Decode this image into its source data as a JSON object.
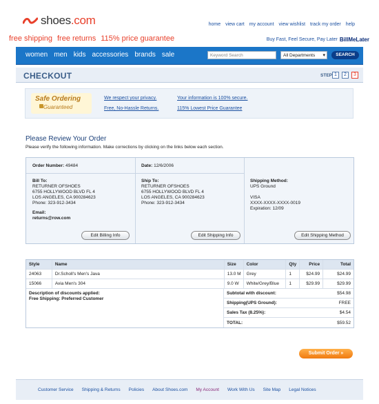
{
  "brand": {
    "logo_text": "shoes",
    "logo_suffix": ".com"
  },
  "top_links": [
    "home",
    "view cart",
    "my account",
    "view wishlist",
    "track my order",
    "help"
  ],
  "promo": [
    "free shipping",
    "free returns",
    "115% price guarantee"
  ],
  "bml": {
    "text": "Buy Fast, Feel Secure, Pay Later",
    "badge": "BillMeLater"
  },
  "nav": {
    "items": [
      "women",
      "men",
      "kids",
      "accessories",
      "brands",
      "sale"
    ],
    "search_placeholder": "Keyword Search",
    "dept_selected": "All Departments",
    "search_button": "SEARCH"
  },
  "checkout": {
    "title": "CHECKOUT",
    "step_label": "STEP",
    "steps": [
      "1",
      "2",
      "3"
    ],
    "current_step": "3"
  },
  "safe": {
    "badge_l1": "Safe Ordering",
    "badge_l2": "Guaranteed",
    "links": [
      "We respect your privacy.",
      "Your information is 100% secure.",
      "Free, No-Hassle Returns.",
      "115% Lowest Price Guarantee"
    ]
  },
  "review": {
    "title": "Please Review Your Order",
    "subtitle": "Please verify the following information. Make corrections by clicking on the links below each section."
  },
  "order": {
    "number_label": "Order Number:",
    "number": "49484",
    "date_label": "Date:",
    "date": "12/6/2006",
    "bill_label": "Bill To:",
    "bill_lines": [
      "RETURNER OFSHOES",
      "6755 HOLLYWOOD BLVD FL 4",
      "LOS ANGELES, CA 900284623",
      "Phone: 323-912-3434"
    ],
    "email_label": "Email:",
    "email": "returns@row.com",
    "ship_label": "Ship To:",
    "ship_lines": [
      "RETURNER OFSHOES",
      "6755 HOLLYWOOD BLVD FL 4",
      "LOS ANGELES, CA 900284623",
      "Phone: 323-912-3434"
    ],
    "method_label": "Shipping Method:",
    "method": "UPS Ground",
    "card_type": "VISA",
    "card_number": "XXXX-XXXX-XXXX-0019",
    "card_exp": "Expiration: 12/09",
    "edit_billing": "Edit Billing Info",
    "edit_shipping": "Edit Shipping Info",
    "edit_method": "Edit Shipping Method"
  },
  "items": {
    "headers": [
      "Style",
      "Name",
      "Size",
      "Color",
      "Qty",
      "Price",
      "Total"
    ],
    "rows": [
      [
        "24063",
        "Dr.Scholl's Men's Java",
        "13.0 M",
        "Grey",
        "1",
        "$24.99",
        "$24.99"
      ],
      [
        "15066",
        "Avia Men's 304",
        "9.0 W",
        "White/Grey/Blue",
        "1",
        "$29.99",
        "$29.99"
      ]
    ],
    "discount_l1": "Description of discounts applied:",
    "discount_l2": "Free Shipping: Preferred Customer",
    "totals": [
      {
        "k": "Subtotal with discount:",
        "v": "$54.98"
      },
      {
        "k": "Shipping(UPS Ground):",
        "v": "FREE"
      },
      {
        "k": "Sales Tax (8.25%):",
        "v": "$4.54"
      },
      {
        "k": "TOTAL:",
        "v": "$59.52"
      }
    ]
  },
  "submit_label": "Submit Order",
  "footer": [
    "Customer Service",
    "Shipping & Returns",
    "Policies",
    "About Shoes.com",
    "My Account",
    "Work With Us",
    "Site Map",
    "Legal Notices"
  ]
}
